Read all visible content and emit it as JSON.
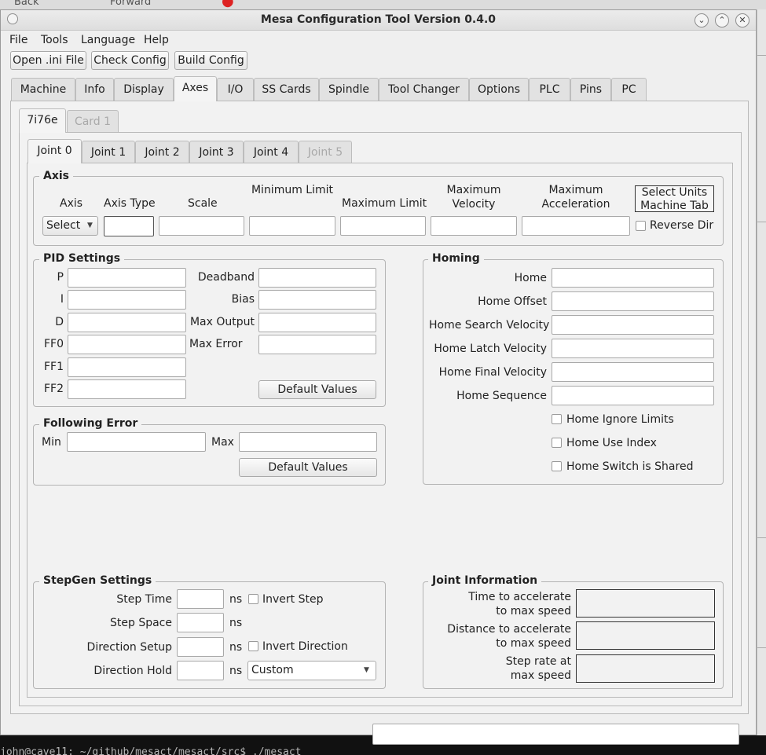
{
  "background": {
    "browser_back": "Back",
    "browser_forward": "Forward",
    "terminal_text": "john@cave11: ~/github/mesact/mesact/src$ ./mesact"
  },
  "window": {
    "title": "Mesa Configuration Tool Version 0.4.0"
  },
  "menu": [
    "File",
    "Tools",
    "Language",
    "Help"
  ],
  "toolbar": {
    "open": "Open .ini File",
    "check": "Check Config",
    "build": "Build Config"
  },
  "main_tabs": [
    "Machine",
    "Info",
    "Display",
    "Axes",
    "I/O",
    "SS Cards",
    "Spindle",
    "Tool Changer",
    "Options",
    "PLC",
    "Pins",
    "PC"
  ],
  "main_tab_active": "Axes",
  "card_tabs": [
    "7i76e",
    "Card 1"
  ],
  "joint_tabs": [
    "Joint 0",
    "Joint 1",
    "Joint 2",
    "Joint 3",
    "Joint 4",
    "Joint 5"
  ],
  "axis": {
    "title": "Axis",
    "col_axis": "Axis",
    "col_axis_type": "Axis Type",
    "col_scale": "Scale",
    "col_min_limit": "Minimum Limit",
    "col_max_limit": "Maximum Limit",
    "col_max_velocity": "Maximum Velocity",
    "col_max_accel": "Maximum Acceleration",
    "select_units_line1": "Select Units",
    "select_units_line2": "Machine Tab",
    "axis_select_value": "Select",
    "reverse_dir": "Reverse Dir"
  },
  "pid": {
    "title": "PID Settings",
    "p": "P",
    "i": "I",
    "d": "D",
    "ff0": "FF0",
    "ff1": "FF1",
    "ff2": "FF2",
    "deadband": "Deadband",
    "bias": "Bias",
    "max_output": "Max Output",
    "max_error": "Max Error",
    "default_values": "Default Values"
  },
  "homing": {
    "title": "Homing",
    "home": "Home",
    "home_offset": "Home Offset",
    "home_search_velocity": "Home Search Velocity",
    "home_latch_velocity": "Home Latch Velocity",
    "home_final_velocity": "Home Final Velocity",
    "home_sequence": "Home Sequence",
    "home_ignore_limits": "Home Ignore Limits",
    "home_use_index": "Home Use Index",
    "home_switch_shared": "Home Switch is Shared"
  },
  "following_error": {
    "title": "Following Error",
    "min": "Min",
    "max": "Max",
    "default_values": "Default Values"
  },
  "stepgen": {
    "title": "StepGen Settings",
    "step_time": "Step Time",
    "step_space": "Step Space",
    "direction_setup": "Direction Setup",
    "direction_hold": "Direction Hold",
    "unit": "ns",
    "invert_step": "Invert Step",
    "invert_direction": "Invert Direction",
    "drive_value": "Custom"
  },
  "joint_info": {
    "title": "Joint Information",
    "time_accel_1": "Time to accelerate",
    "time_accel_2": "to max speed",
    "dist_accel_1": "Distance to accelerate",
    "dist_accel_2": "to max speed",
    "step_rate_1": "Step rate at",
    "step_rate_2": "max speed"
  }
}
